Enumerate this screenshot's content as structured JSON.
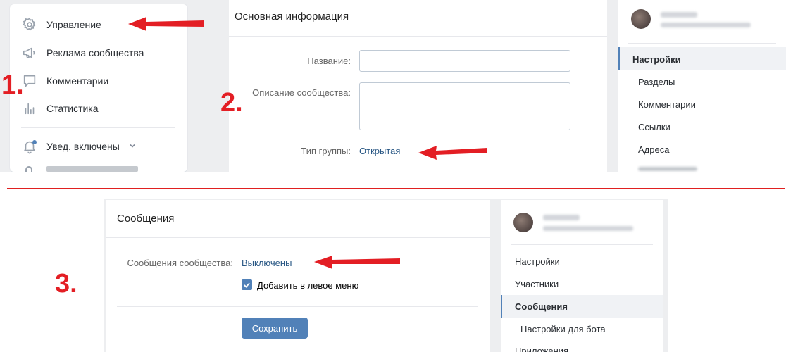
{
  "left_menu": {
    "items": [
      {
        "label": "Управление",
        "icon": "gear-icon"
      },
      {
        "label": "Реклама сообщества",
        "icon": "megaphone-icon"
      },
      {
        "label": "Комментарии",
        "icon": "comment-icon"
      },
      {
        "label": "Статистика",
        "icon": "stats-icon"
      }
    ],
    "notifications": {
      "label": "Увед. включены",
      "icon": "bell-icon"
    }
  },
  "basic_info": {
    "title": "Основная информация",
    "name_label": "Название:",
    "name_value": "",
    "description_label": "Описание сообщества:",
    "description_value": "",
    "group_type_label": "Тип группы:",
    "group_type_value": "Открытая"
  },
  "settings_nav": {
    "items": [
      {
        "label": "Настройки",
        "active": true
      },
      {
        "label": "Разделы",
        "active": false
      },
      {
        "label": "Комментарии",
        "active": false
      },
      {
        "label": "Ссылки",
        "active": false
      },
      {
        "label": "Адреса",
        "active": false
      }
    ]
  },
  "messages": {
    "title": "Сообщения",
    "community_messages_label": "Сообщения сообщества:",
    "community_messages_value": "Выключены",
    "add_to_left_menu_label": "Добавить в левое меню",
    "add_to_left_menu_checked": true,
    "save_label": "Сохранить"
  },
  "settings_nav_2": {
    "items": [
      {
        "label": "Настройки",
        "active": false
      },
      {
        "label": "Участники",
        "active": false
      },
      {
        "label": "Сообщения",
        "active": true
      },
      {
        "label": "Настройки для бота",
        "active": false
      },
      {
        "label": "Приложения",
        "active": false
      }
    ]
  },
  "step_labels": [
    "1.",
    "2.",
    "3."
  ],
  "colors": {
    "accent": "#5181b8",
    "link": "#2a5885",
    "annotation_red": "#e31e24",
    "background": "#edeef0"
  }
}
